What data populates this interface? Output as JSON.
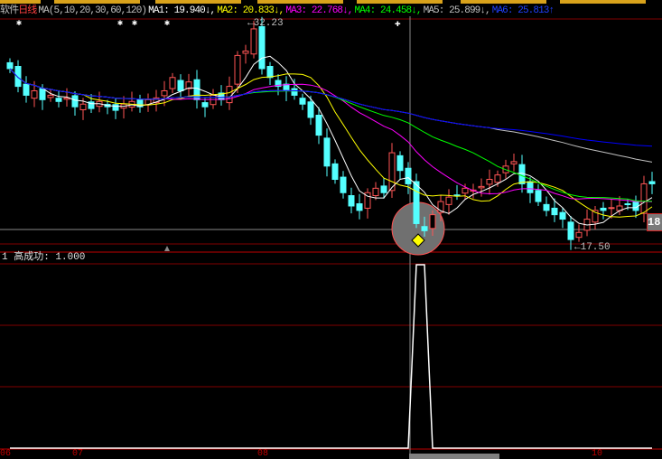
{
  "header": {
    "prefix": "软件",
    "period": "日线",
    "ma_params": "MA(5,10,20,30,60,120)",
    "ma1": "MA1: 19.940↓,",
    "ma2": "MA2: 20.833↓,",
    "ma3": "MA3: 22.768↓,",
    "ma4": "MA4: 24.458↓,",
    "ma5": "MA5: 25.899↓,",
    "ma6": "MA6: 25.813↑"
  },
  "indicator": {
    "label": "1 高成功: 1.000"
  },
  "colors": {
    "up": "#ff5555",
    "down": "#54ffff",
    "ma1": "#ffffff",
    "ma2": "#ffff00",
    "ma3": "#ff00ff",
    "ma4": "#00ff00",
    "ma5": "#c0c0c0",
    "ma6": "#0000ff",
    "grid": "#800000"
  },
  "chart_data": {
    "type": "candlestick",
    "title": "日线",
    "high_label": "32.23",
    "low_label": "17.50",
    "last_price_label": "18",
    "x_labels": [
      "06",
      "07",
      "08",
      "10"
    ],
    "ylim": [
      17.2,
      32.6
    ],
    "closes": [
      29.18,
      27.98,
      27.38,
      27.68,
      27.08,
      27.38,
      26.96,
      27.2,
      26.6,
      26.78,
      26.48,
      26.96,
      26.6,
      26.36,
      26.78,
      26.96,
      26.6,
      27.08,
      27.2,
      27.68,
      28.58,
      27.68,
      28.28,
      27.08,
      26.6,
      27.38,
      27.08,
      27.98,
      30.07,
      30.37,
      31.87,
      29.18,
      28.58,
      27.98,
      27.68,
      27.38,
      26.78,
      25.88,
      24.68,
      22.59,
      21.69,
      20.79,
      19.89,
      19.59,
      20.79,
      21.09,
      20.79,
      23.49,
      22.29,
      21.39,
      18.7,
      18.22,
      19.3,
      20.19,
      20.49,
      20.61,
      21.09,
      20.97,
      21.21,
      21.69,
      21.99,
      22.59,
      22.89,
      21.39,
      20.79,
      20.19,
      19.59,
      19.3,
      19.0,
      17.62,
      18.1,
      19.0,
      19.59,
      19.59,
      19.78,
      19.89,
      20.02,
      19.59,
      21.39,
      21.39
    ],
    "signal_index": 50,
    "indicator_values_nonzero": [
      50,
      51
    ]
  }
}
